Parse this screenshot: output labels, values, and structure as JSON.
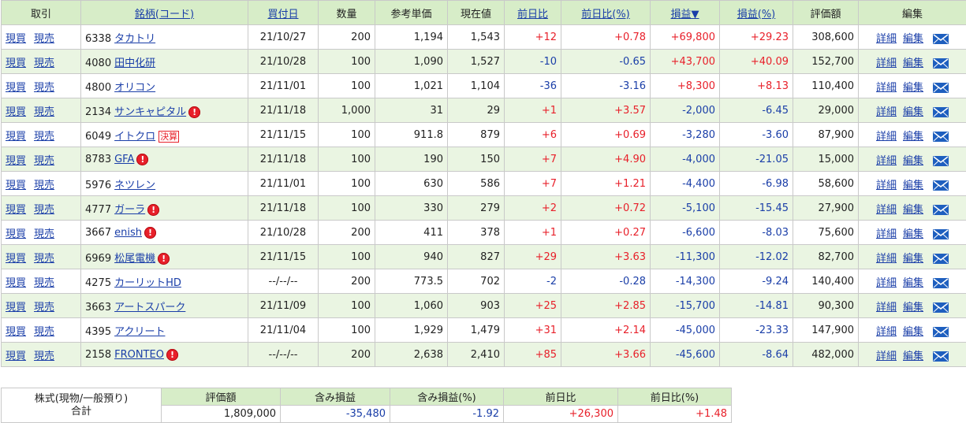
{
  "headers": {
    "trade": "取引",
    "name": "銘柄(コード)",
    "date": "買付日",
    "qty": "数量",
    "ref_price": "参考単価",
    "price": "現在値",
    "change": "前日比",
    "change_pct": "前日比(%)",
    "pl": "損益▼",
    "pl_pct": "損益(%)",
    "value": "評価額",
    "edit": "編集"
  },
  "labels": {
    "buy": "現買",
    "sell": "現売",
    "detail": "詳細",
    "edit": "編集",
    "kessan": "決算",
    "alert": "!"
  },
  "rows": [
    {
      "code": "6338",
      "name": "タカトリ",
      "date": "21/10/27",
      "qty": "200",
      "ref": "1,194",
      "price": "1,543",
      "chg": "+12",
      "chgp": "+0.78",
      "pl": "+69,800",
      "plp": "+29.23",
      "value": "308,600",
      "alert": false,
      "kessan": false
    },
    {
      "code": "4080",
      "name": "田中化研",
      "date": "21/10/28",
      "qty": "100",
      "ref": "1,090",
      "price": "1,527",
      "chg": "-10",
      "chgp": "-0.65",
      "pl": "+43,700",
      "plp": "+40.09",
      "value": "152,700",
      "alert": false,
      "kessan": false
    },
    {
      "code": "4800",
      "name": "オリコン",
      "date": "21/11/01",
      "qty": "100",
      "ref": "1,021",
      "price": "1,104",
      "chg": "-36",
      "chgp": "-3.16",
      "pl": "+8,300",
      "plp": "+8.13",
      "value": "110,400",
      "alert": false,
      "kessan": false
    },
    {
      "code": "2134",
      "name": "サンキャピタル",
      "date": "21/11/18",
      "qty": "1,000",
      "ref": "31",
      "price": "29",
      "chg": "+1",
      "chgp": "+3.57",
      "pl": "-2,000",
      "plp": "-6.45",
      "value": "29,000",
      "alert": true,
      "kessan": false
    },
    {
      "code": "6049",
      "name": "イトクロ",
      "date": "21/11/15",
      "qty": "100",
      "ref": "911.8",
      "price": "879",
      "chg": "+6",
      "chgp": "+0.69",
      "pl": "-3,280",
      "plp": "-3.60",
      "value": "87,900",
      "alert": false,
      "kessan": true
    },
    {
      "code": "8783",
      "name": "GFA",
      "date": "21/11/18",
      "qty": "100",
      "ref": "190",
      "price": "150",
      "chg": "+7",
      "chgp": "+4.90",
      "pl": "-4,000",
      "plp": "-21.05",
      "value": "15,000",
      "alert": true,
      "kessan": false
    },
    {
      "code": "5976",
      "name": "ネツレン",
      "date": "21/11/01",
      "qty": "100",
      "ref": "630",
      "price": "586",
      "chg": "+7",
      "chgp": "+1.21",
      "pl": "-4,400",
      "plp": "-6.98",
      "value": "58,600",
      "alert": false,
      "kessan": false
    },
    {
      "code": "4777",
      "name": "ガーラ",
      "date": "21/11/18",
      "qty": "100",
      "ref": "330",
      "price": "279",
      "chg": "+2",
      "chgp": "+0.72",
      "pl": "-5,100",
      "plp": "-15.45",
      "value": "27,900",
      "alert": true,
      "kessan": false
    },
    {
      "code": "3667",
      "name": "enish",
      "date": "21/10/28",
      "qty": "200",
      "ref": "411",
      "price": "378",
      "chg": "+1",
      "chgp": "+0.27",
      "pl": "-6,600",
      "plp": "-8.03",
      "value": "75,600",
      "alert": true,
      "kessan": false
    },
    {
      "code": "6969",
      "name": "松尾電機",
      "date": "21/11/15",
      "qty": "100",
      "ref": "940",
      "price": "827",
      "chg": "+29",
      "chgp": "+3.63",
      "pl": "-11,300",
      "plp": "-12.02",
      "value": "82,700",
      "alert": true,
      "kessan": false
    },
    {
      "code": "4275",
      "name": "カーリットHD",
      "date": "--/--/--",
      "qty": "200",
      "ref": "773.5",
      "price": "702",
      "chg": "-2",
      "chgp": "-0.28",
      "pl": "-14,300",
      "plp": "-9.24",
      "value": "140,400",
      "alert": false,
      "kessan": false
    },
    {
      "code": "3663",
      "name": "アートスパーク",
      "date": "21/11/09",
      "qty": "100",
      "ref": "1,060",
      "price": "903",
      "chg": "+25",
      "chgp": "+2.85",
      "pl": "-15,700",
      "plp": "-14.81",
      "value": "90,300",
      "alert": false,
      "kessan": false
    },
    {
      "code": "4395",
      "name": "アクリート",
      "date": "21/11/04",
      "qty": "100",
      "ref": "1,929",
      "price": "1,479",
      "chg": "+31",
      "chgp": "+2.14",
      "pl": "-45,000",
      "plp": "-23.33",
      "value": "147,900",
      "alert": false,
      "kessan": false
    },
    {
      "code": "2158",
      "name": "FRONTEO",
      "date": "--/--/--",
      "qty": "200",
      "ref": "2,638",
      "price": "2,410",
      "chg": "+85",
      "chgp": "+3.66",
      "pl": "-45,600",
      "plp": "-8.64",
      "value": "482,000",
      "alert": true,
      "kessan": false
    }
  ],
  "summary": {
    "label_line1": "株式(現物/一般預り)",
    "label_line2": "合計",
    "h_value": "評価額",
    "h_pl": "含み損益",
    "h_pl_pct": "含み損益(%)",
    "h_chg": "前日比",
    "h_chg_pct": "前日比(%)",
    "value": "1,809,000",
    "pl": "-35,480",
    "pl_pct": "-1.92",
    "chg": "+26,300",
    "chg_pct": "+1.48"
  },
  "colors": {
    "positive": "#e8202a",
    "negative": "#1a3ea8",
    "header_bg": "#d7edc8",
    "row_alt_bg": "#eaf5e2"
  }
}
